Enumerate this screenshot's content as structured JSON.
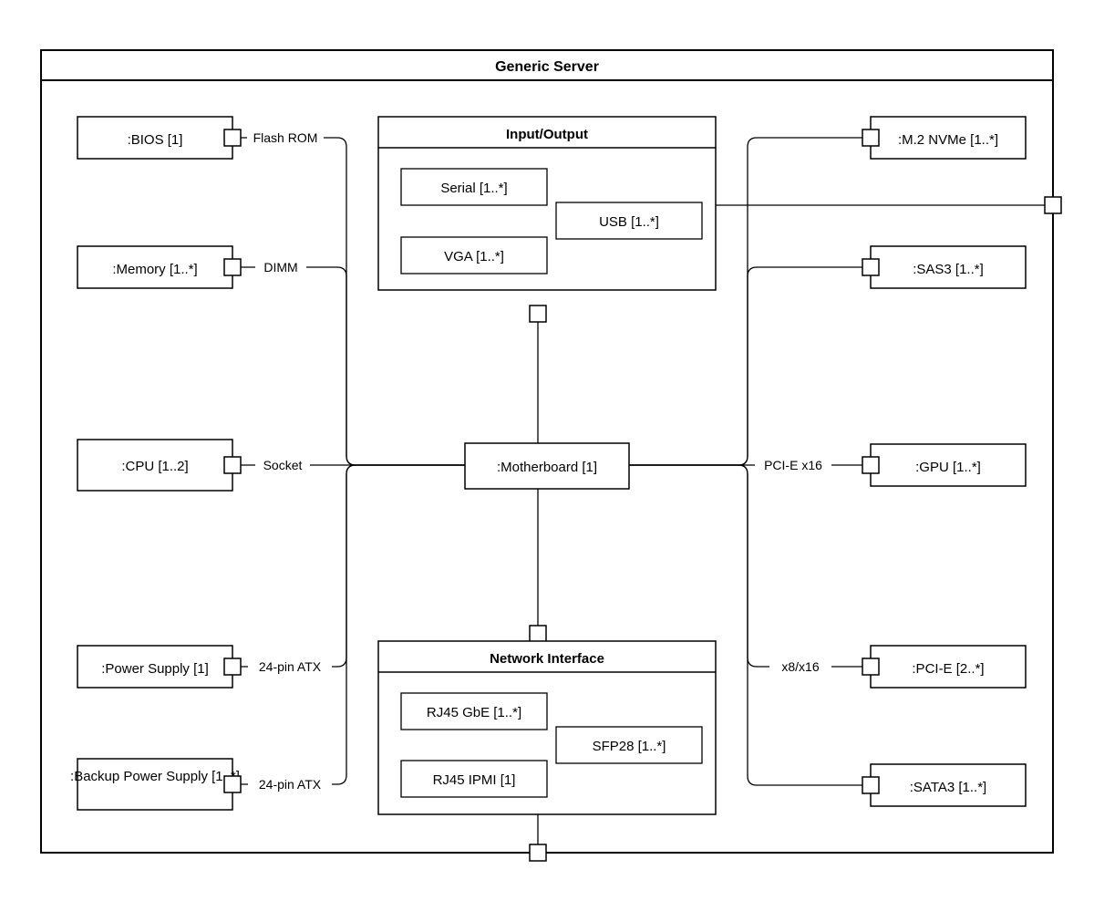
{
  "frame": {
    "title": "Generic Server"
  },
  "left": {
    "bios": {
      "label": ":BIOS [1]",
      "edge": "Flash ROM"
    },
    "memory": {
      "label": ":Memory [1..*]",
      "edge": "DIMM"
    },
    "cpu": {
      "label": ":CPU [1..2]",
      "edge": "Socket"
    },
    "psu": {
      "label": ":Power Supply [1]",
      "edge": "24-pin ATX"
    },
    "bpsu": {
      "label": ":Backup Power Supply [1..*]",
      "edge": "24-pin ATX"
    }
  },
  "right": {
    "m2": {
      "label": ":M.2 NVMe [1..*]",
      "edge": ""
    },
    "sas3": {
      "label": ":SAS3 [1..*]",
      "edge": ""
    },
    "gpu": {
      "label": ":GPU [1..*]",
      "edge": "PCI-E x16"
    },
    "pcie": {
      "label": ":PCI-E [2..*]",
      "edge": "x8/x16"
    },
    "sata": {
      "label": ":SATA3 [1..*]",
      "edge": ""
    }
  },
  "io": {
    "title": "Input/Output",
    "serial": "Serial [1..*]",
    "usb": "USB [1..*]",
    "vga": "VGA [1..*]"
  },
  "mb": {
    "label": ":Motherboard [1]"
  },
  "net": {
    "title": "Network Interface",
    "rj45gbe": "RJ45 GbE [1..*]",
    "sfp28": "SFP28 [1..*]",
    "rj45ipmi": "RJ45 IPMI [1]"
  }
}
